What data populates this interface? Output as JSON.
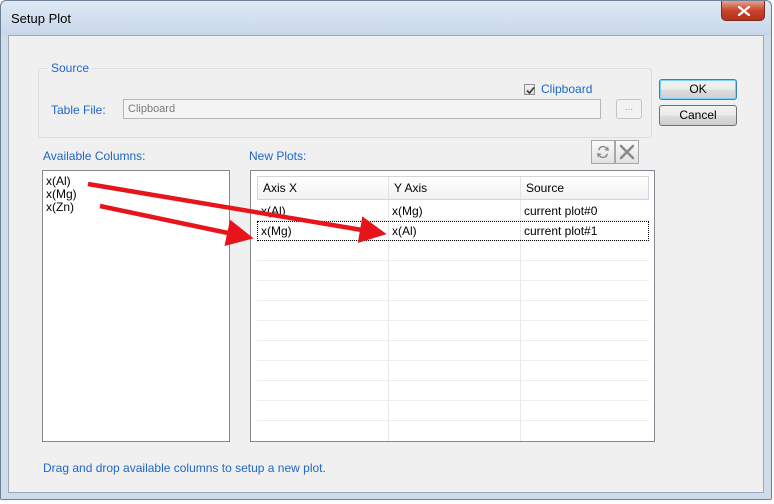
{
  "window": {
    "title": "Setup Plot",
    "close_icon": "close-x-icon"
  },
  "source": {
    "legend": "Source",
    "clipboard_label": "Clipboard",
    "clipboard_checked": true,
    "table_file_label": "Table File:",
    "table_file_value": "Clipboard",
    "browse_label": "..."
  },
  "buttons": {
    "ok": "OK",
    "cancel": "Cancel"
  },
  "available": {
    "label": "Available Columns:",
    "items": [
      "x(Al)",
      "x(Mg)",
      "x(Zn)"
    ]
  },
  "new_plots": {
    "label": "New Plots:",
    "swap_icon": "swap-arrows-icon",
    "delete_icon": "delete-x-icon",
    "columns": [
      "Axis X",
      "Y Axis",
      "Source"
    ],
    "rows": [
      [
        "x(Al)",
        "x(Mg)",
        "current plot#0"
      ],
      [
        "x(Mg)",
        "x(Al)",
        "current plot#1"
      ]
    ]
  },
  "hint": "Drag and drop available columns to setup a new plot.",
  "colors": {
    "label_blue": "#1f66c9",
    "arrow_red": "#e8141b"
  }
}
